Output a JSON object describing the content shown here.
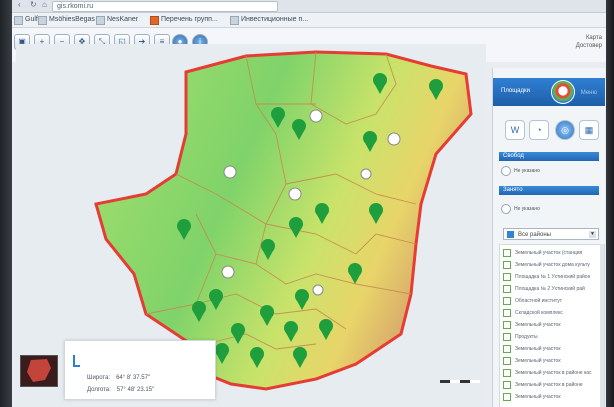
{
  "browser": {
    "url": "gis.rkomi.ru",
    "back_icon": "chevron-left-icon",
    "bookmarks": [
      {
        "label": "Gulfe"
      },
      {
        "label": "MsöhiesBegas"
      },
      {
        "label": "NesKaner"
      },
      {
        "label": "Перечень групп..."
      },
      {
        "label": "Инвестиционные п..."
      }
    ]
  },
  "header": {
    "right_text_1": "Карта",
    "right_text_2": "Достовер"
  },
  "panel": {
    "title": "Площадки",
    "title_right": "Меню",
    "section1": "Свобод",
    "section1_item": "Не указано",
    "section2": "Занято",
    "section2_item": "Не указано",
    "dropdown": "Все районы",
    "list_items": [
      "Земельный участок (станция",
      "Земельный участок дома культу",
      "Площадка № 1 Ухтинский район",
      "Площадка № 2 Ухтинский рай",
      "Областной институт",
      "Складской комплекс",
      "Земельный участок",
      "Продукты",
      "Земельный участок",
      "Земельный участок",
      "Земельный участок в районе кас",
      "Земельный участок в районе",
      "Земельный участок"
    ]
  },
  "coords": {
    "lat_label": "Широта:",
    "lat_value": "64° 8' 37.57\"",
    "lon_label": "Долгота:",
    "lon_value": "57° 48' 23.15\""
  },
  "colors": {
    "region_border": "#e53c34",
    "marker": "#1e9e3c",
    "panel_accent": "#2166b3"
  }
}
